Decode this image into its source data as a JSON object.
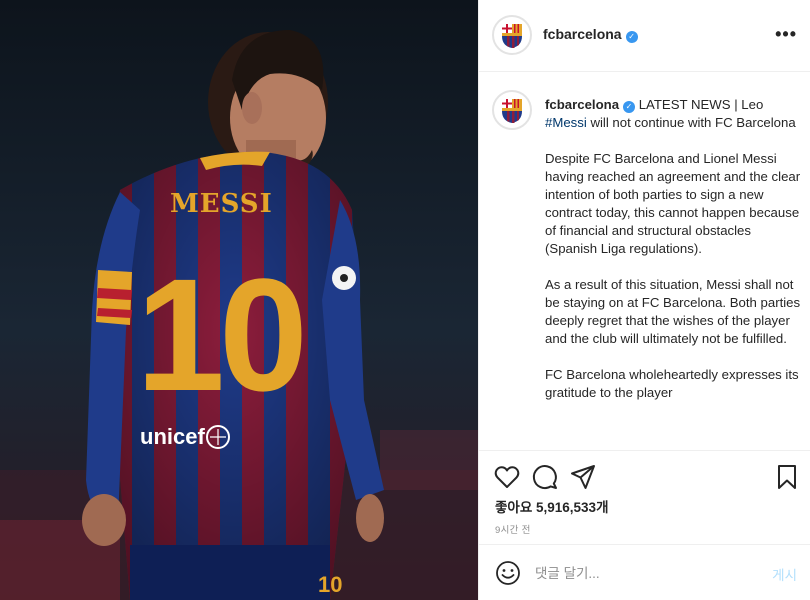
{
  "post": {
    "username": "fcbarcelona",
    "verified_mark": "✓",
    "more_label": "•••",
    "caption": {
      "headline": " LATEST NEWS | Leo ",
      "hashtag": "#Messi",
      "headline_rest": " will not continue with FC Barcelona",
      "paragraphs": [
        "Despite FC Barcelona and Lionel Messi having reached an agreement and the clear intention of both parties to sign a new contract today, this cannot happen because of financial and structural obstacles (Spanish Liga regulations).",
        "As a result of this situation, Messi shall not be staying on at FC Barcelona. Both parties deeply regret that the wishes of the player and the club will ultimately not be fulfilled.",
        "FC Barcelona wholeheartedly expresses its gratitude to the player"
      ]
    },
    "likes_label": "좋아요 5,916,533개",
    "time_ago": "9시간 전",
    "comment_placeholder": "댓글 달기...",
    "post_button": "게시"
  },
  "photo": {
    "jersey_name": "MESSI",
    "jersey_number": "10",
    "sponsor": "unicef",
    "shorts_number": "10"
  },
  "icons": {
    "header_avatar": "fcb-crest-icon",
    "like": "heart-icon",
    "comment": "comment-bubble-icon",
    "share": "paper-plane-icon",
    "save": "bookmark-icon",
    "emoji": "smiley-icon"
  },
  "colors": {
    "verified": "#3897f0",
    "hashtag": "#00376b",
    "post_button": "#b2dffc",
    "muted": "#8e8e8e",
    "jersey_blue": "#1f3b8a",
    "jersey_red": "#8c1d3c",
    "jersey_gold": "#e4a52a"
  }
}
